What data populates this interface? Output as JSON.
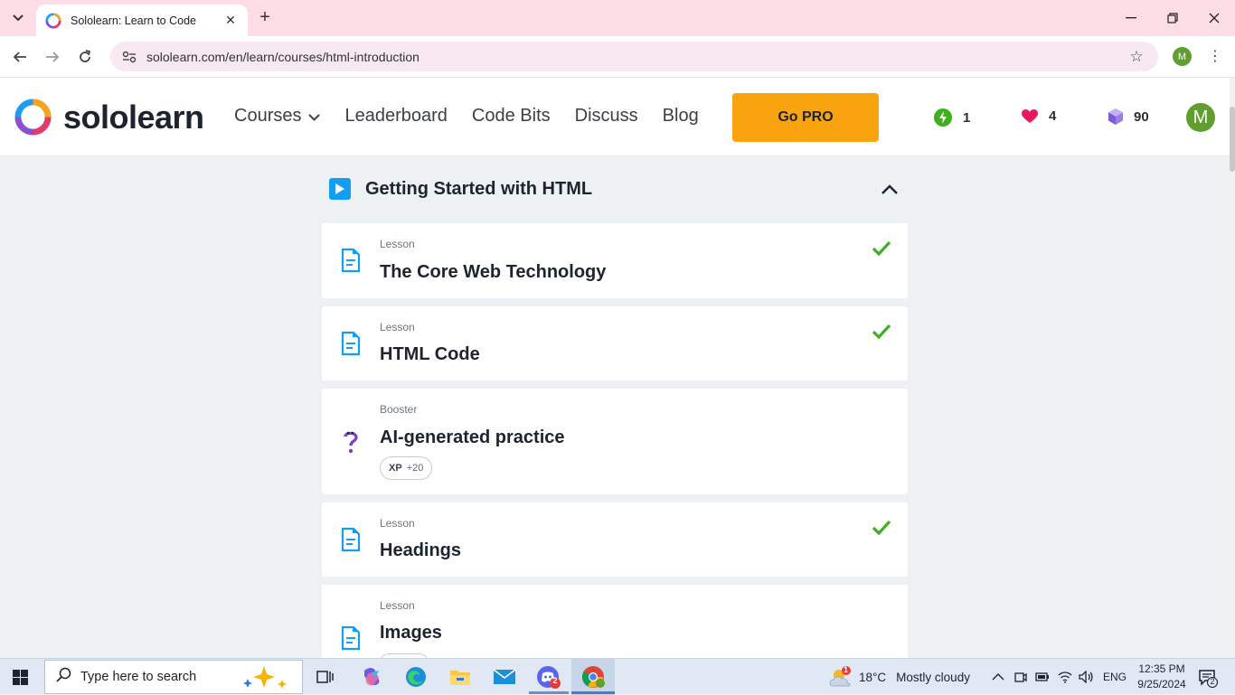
{
  "browser": {
    "tab_title": "Sololearn: Learn to Code",
    "url": "sololearn.com/en/learn/courses/html-introduction",
    "profile_initial": "M"
  },
  "header": {
    "logo_text": "sololearn",
    "nav": [
      "Courses",
      "Leaderboard",
      "Code Bits",
      "Discuss",
      "Blog"
    ],
    "go_pro": "Go PRO",
    "streak": "1",
    "hearts": "4",
    "gems": "90",
    "avatar_initial": "M"
  },
  "section": {
    "title": "Getting Started with HTML"
  },
  "cards": [
    {
      "kind": "Lesson",
      "title": "The Core Web Technology",
      "completed": true,
      "icon": "lesson-icon"
    },
    {
      "kind": "Lesson",
      "title": "HTML Code",
      "completed": true,
      "icon": "lesson-icon"
    },
    {
      "kind": "Booster",
      "title": "AI-generated practice",
      "completed": false,
      "icon": "question-icon",
      "xp_label": "XP",
      "xp_value": "+20"
    },
    {
      "kind": "Lesson",
      "title": "Headings",
      "completed": true,
      "icon": "lesson-icon"
    },
    {
      "kind": "Lesson",
      "title": "Images",
      "completed": false,
      "icon": "lesson-icon"
    }
  ],
  "taskbar": {
    "search_placeholder": "Type here to search",
    "weather_temp": "18°C",
    "weather_desc": "Mostly cloudy",
    "weather_badge": "1",
    "language": "ENG",
    "time": "12:35 PM",
    "date": "9/25/2024",
    "notification_count": "2",
    "discord_badge": "2"
  },
  "colors": {
    "accent_blue": "#149ef2",
    "pro_orange": "#f9a30f",
    "check_green": "#3eaf1f",
    "booster_purple": "#7b3fc4"
  }
}
